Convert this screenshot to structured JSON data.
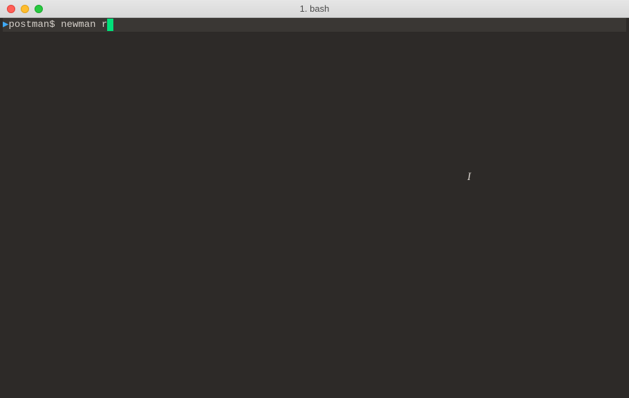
{
  "window": {
    "title": "1. bash"
  },
  "terminal": {
    "prompt_caret": "▶",
    "prompt": "postman$",
    "command": "newman r",
    "text_cursor_glyph": "I"
  }
}
